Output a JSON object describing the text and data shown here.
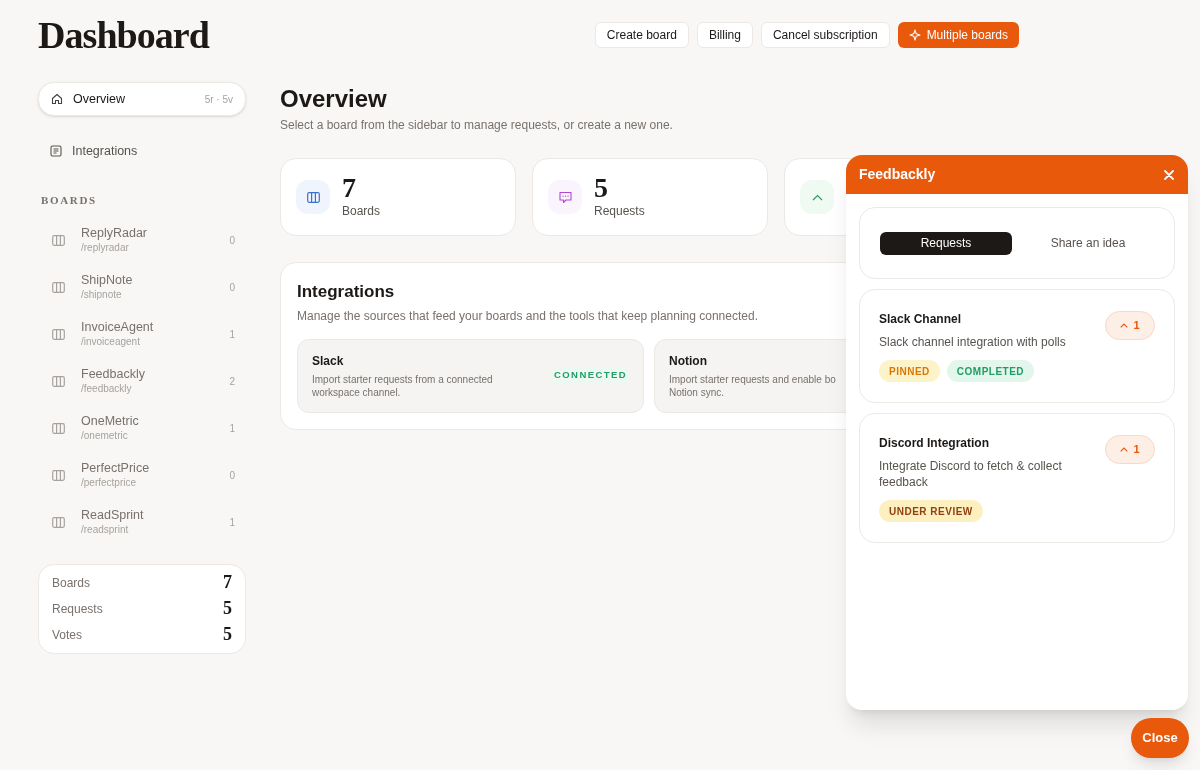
{
  "header": {
    "title": "Dashboard",
    "buttons": [
      {
        "label": "Create board",
        "kind": "plain"
      },
      {
        "label": "Billing",
        "kind": "plain"
      },
      {
        "label": "Cancel subscription",
        "kind": "plain"
      },
      {
        "label": "Multiple boards",
        "kind": "primary"
      }
    ]
  },
  "sidebar": {
    "nav": [
      {
        "label": "Overview",
        "meta": "5r · 5v",
        "selected": true,
        "kind": "home"
      },
      {
        "label": "Integrations",
        "selected": false,
        "kind": "list"
      }
    ],
    "boards_heading": "BOARDS",
    "boards": [
      {
        "name": "ReplyRadar",
        "slug": "/replyradar",
        "count": "0"
      },
      {
        "name": "ShipNote",
        "slug": "/shipnote",
        "count": "0"
      },
      {
        "name": "InvoiceAgent",
        "slug": "/invoiceagent",
        "count": "1"
      },
      {
        "name": "Feedbackly",
        "slug": "/feedbackly",
        "count": "2"
      },
      {
        "name": "OneMetric",
        "slug": "/onemetric",
        "count": "1"
      },
      {
        "name": "PerfectPrice",
        "slug": "/perfectprice",
        "count": "0"
      },
      {
        "name": "ReadSprint",
        "slug": "/readsprint",
        "count": "1"
      }
    ],
    "stats": [
      {
        "label": "Boards",
        "value": "7"
      },
      {
        "label": "Requests",
        "value": "5"
      },
      {
        "label": "Votes",
        "value": "5"
      }
    ]
  },
  "overview": {
    "title": "Overview",
    "subtitle": "Select a board from the sidebar to manage requests, or create a new one.",
    "stats": [
      {
        "kind": "boards",
        "value": "7",
        "label": "Boards"
      },
      {
        "kind": "requests",
        "value": "5",
        "label": "Requests"
      },
      {
        "kind": "votes"
      }
    ],
    "integrations": {
      "title": "Integrations",
      "subtitle": "Manage the sources that feed your boards and the tools that keep planning connected.",
      "items": [
        {
          "name": "Slack",
          "lines": [
            "Import starter requests from a connected",
            "workspace channel."
          ],
          "status": "CONNECTED"
        },
        {
          "name": "Notion",
          "lines": [
            "Import starter requests and enable bo",
            "Notion sync."
          ]
        }
      ]
    }
  },
  "widget": {
    "title": "Feedbackly",
    "tabs": [
      {
        "label": "Requests",
        "selected": true
      },
      {
        "label": "Share an idea",
        "selected": false
      }
    ],
    "requests": [
      {
        "title": "Slack Channel",
        "description": "Slack channel integration with polls",
        "votes": "1",
        "tags": [
          {
            "label": "PINNED",
            "kind": "pinned"
          },
          {
            "label": "COMPLETED",
            "kind": "completed"
          }
        ]
      },
      {
        "title": "Discord Integration",
        "description": "Integrate Discord to fetch & collect feedback",
        "votes": "1",
        "tags": [
          {
            "label": "UNDER REVIEW",
            "kind": "review"
          }
        ]
      }
    ]
  },
  "close_button": "Close"
}
